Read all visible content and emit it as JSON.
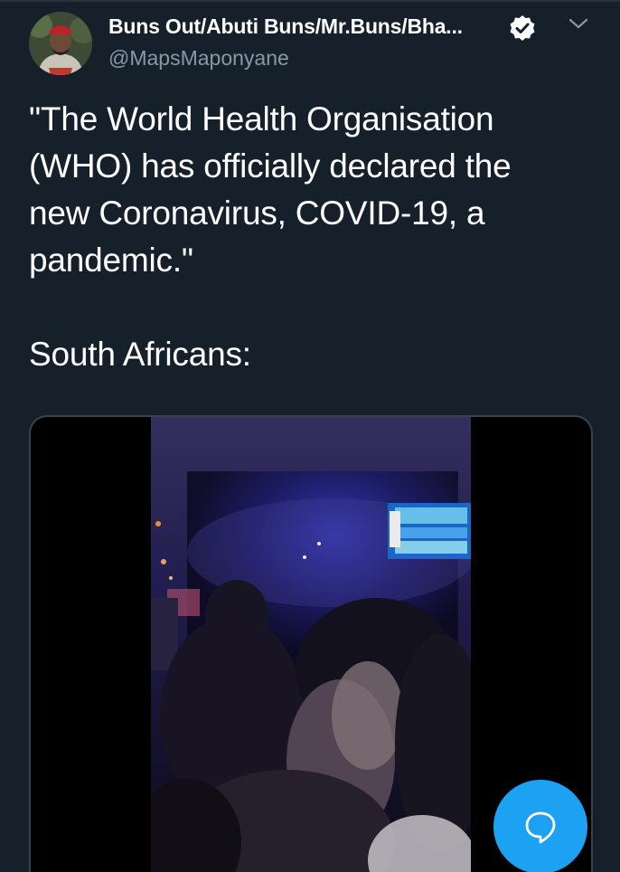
{
  "tweet": {
    "author_name": "Buns Out/Abuti Buns/Mr.Buns/Bha...",
    "handle": "@MapsMaponyane",
    "text_lines": [
      "\"The World Health Organisation",
      "(WHO) has officially declared the",
      "new Coronavirus, COVID-19, a",
      "pandemic.\""
    ],
    "text_reply": "South Africans:"
  },
  "icons": {
    "verified": "verified-badge-icon",
    "more": "chevron-down-icon",
    "compose": "chat-bubble-icon"
  },
  "colors": {
    "background": "#15202b",
    "secondary_text": "#8899a6",
    "accent": "#1da1f2",
    "border": "#38444d"
  }
}
